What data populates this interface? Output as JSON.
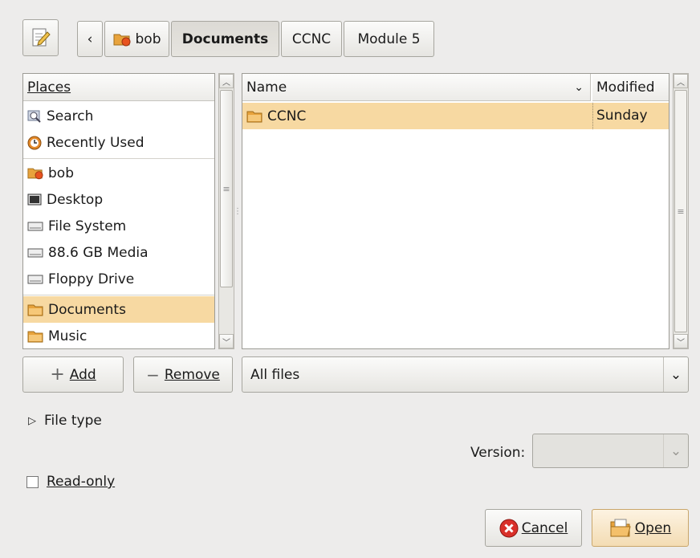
{
  "path_bar": {
    "back_label": "‹",
    "crumbs": [
      "bob",
      "Documents",
      "CCNC",
      "Module 5"
    ]
  },
  "places": {
    "header": "Places",
    "items": [
      "Search",
      "Recently Used",
      "bob",
      "Desktop",
      "File System",
      "88.6 GB Media",
      "Floppy Drive",
      "Documents",
      "Music"
    ],
    "selected": "Documents"
  },
  "files": {
    "col_name": "Name",
    "col_modified": "Modified",
    "rows": [
      {
        "name": "CCNC",
        "modified": "Sunday"
      }
    ]
  },
  "buttons": {
    "add": "Add",
    "remove": "Remove",
    "cancel": "Cancel",
    "open": "Open"
  },
  "filter": {
    "value": "All files"
  },
  "file_type": {
    "label": "File type"
  },
  "version": {
    "label": "Version:",
    "value": ""
  },
  "read_only": {
    "label": "Read-only",
    "checked": false
  },
  "colors": {
    "selection": "#f7d9a2",
    "cancel_red": "#d9302a",
    "folder": "#e8a33c"
  }
}
